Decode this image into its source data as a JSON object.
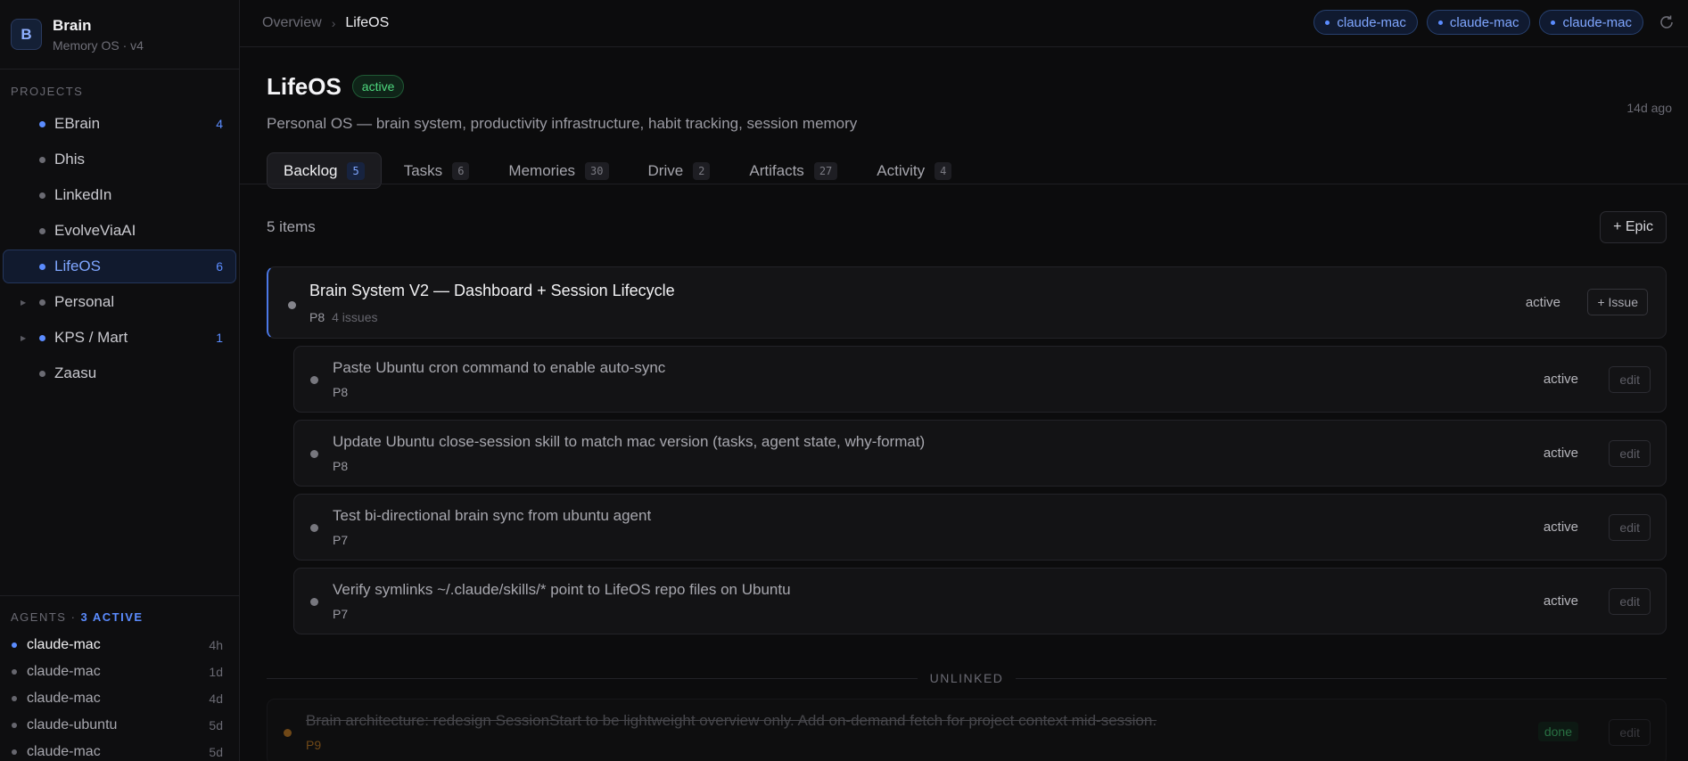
{
  "brand": {
    "logo_letter": "B",
    "title": "Brain",
    "subtitle": "Memory OS · v4"
  },
  "sidebar": {
    "projects_label": "PROJECTS",
    "projects": [
      {
        "name": "EBrain",
        "count": "4",
        "dot": "blue",
        "expandable": false,
        "active": false
      },
      {
        "name": "Dhis",
        "count": "",
        "dot": "gray",
        "expandable": false,
        "active": false
      },
      {
        "name": "LinkedIn",
        "count": "",
        "dot": "gray",
        "expandable": false,
        "active": false
      },
      {
        "name": "EvolveViaAI",
        "count": "",
        "dot": "gray",
        "expandable": false,
        "active": false
      },
      {
        "name": "LifeOS",
        "count": "6",
        "dot": "blue",
        "expandable": false,
        "active": true
      },
      {
        "name": "Personal",
        "count": "",
        "dot": "gray",
        "expandable": true,
        "active": false
      },
      {
        "name": "KPS / Mart",
        "count": "1",
        "dot": "blue",
        "expandable": true,
        "active": false
      },
      {
        "name": "Zaasu",
        "count": "",
        "dot": "gray",
        "expandable": false,
        "active": false
      }
    ],
    "agents_label": "AGENTS",
    "agents_sep": " · ",
    "agents_active": "3 ACTIVE",
    "agents": [
      {
        "name": "claude-mac",
        "time": "4h",
        "dot": "blue"
      },
      {
        "name": "claude-mac",
        "time": "1d",
        "dot": "gray"
      },
      {
        "name": "claude-mac",
        "time": "4d",
        "dot": "gray"
      },
      {
        "name": "claude-ubuntu",
        "time": "5d",
        "dot": "gray"
      },
      {
        "name": "claude-mac",
        "time": "5d",
        "dot": "gray"
      }
    ]
  },
  "topbar": {
    "breadcrumb": [
      "Overview",
      "LifeOS"
    ],
    "breadcrumb_sep": "›",
    "chips": [
      "claude-mac",
      "claude-mac",
      "claude-mac"
    ],
    "refresh_icon": "refresh-icon"
  },
  "project": {
    "title": "LifeOS",
    "status": "active",
    "updated": "14d ago",
    "description": "Personal OS — brain system, productivity infrastructure, habit tracking, session memory"
  },
  "tabs": [
    {
      "label": "Backlog",
      "count": "5",
      "active": true
    },
    {
      "label": "Tasks",
      "count": "6",
      "active": false
    },
    {
      "label": "Memories",
      "count": "30",
      "active": false
    },
    {
      "label": "Drive",
      "count": "2",
      "active": false
    },
    {
      "label": "Artifacts",
      "count": "27",
      "active": false
    },
    {
      "label": "Activity",
      "count": "4",
      "active": false
    }
  ],
  "backlog": {
    "items_count": "5 items",
    "epic_button": "+ Epic",
    "epic": {
      "title": "Brain System V2 — Dashboard + Session Lifecycle",
      "priority": "P8",
      "issues": "4 issues",
      "state": "active",
      "issue_button": "+ Issue"
    },
    "issues": [
      {
        "title": "Paste Ubuntu cron command to enable auto-sync",
        "priority": "P8",
        "state": "active",
        "edit": "edit"
      },
      {
        "title": "Update Ubuntu close-session skill to match mac version (tasks, agent state, why-format)",
        "priority": "P8",
        "state": "active",
        "edit": "edit"
      },
      {
        "title": "Test bi-directional brain sync from ubuntu agent",
        "priority": "P7",
        "state": "active",
        "edit": "edit"
      },
      {
        "title": "Verify symlinks ~/.claude/skills/* point to LifeOS repo files on Ubuntu",
        "priority": "P7",
        "state": "active",
        "edit": "edit"
      }
    ],
    "unlinked_label": "UNLINKED",
    "unlinked": [
      {
        "title": "Brain architecture: redesign SessionStart to be lightweight overview only. Add on-demand fetch for project context mid-session.",
        "priority": "P9",
        "state": "done",
        "edit": "edit"
      }
    ]
  },
  "colors": {
    "accent": "#5b8cff",
    "active_green": "#4fd97f",
    "warning_orange": "#c27a20"
  }
}
